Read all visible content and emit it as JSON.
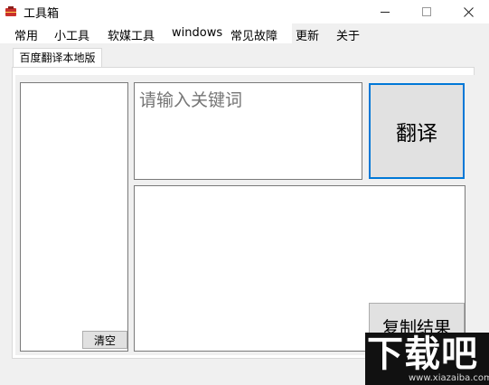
{
  "window": {
    "title": "工具箱",
    "controls": {
      "minimize": "—",
      "maximize": "☐",
      "close": "✕"
    }
  },
  "menu": [
    "常用",
    "小工具",
    "软媒工具",
    "windows",
    "常见故障",
    "更新",
    "关于"
  ],
  "tab": {
    "label": "百度翻译本地版"
  },
  "left_list": {
    "clear_label": "清空"
  },
  "keyword": {
    "placeholder": "请输入关键词",
    "value": ""
  },
  "translate_label": "翻译",
  "result": {
    "value": ""
  },
  "copy_label": "复制结果",
  "watermark": {
    "text": "下载吧",
    "url": "www.xiazaiba.com"
  },
  "colors": {
    "focus_border": "#0078d7",
    "button_face": "#e1e1e1"
  }
}
